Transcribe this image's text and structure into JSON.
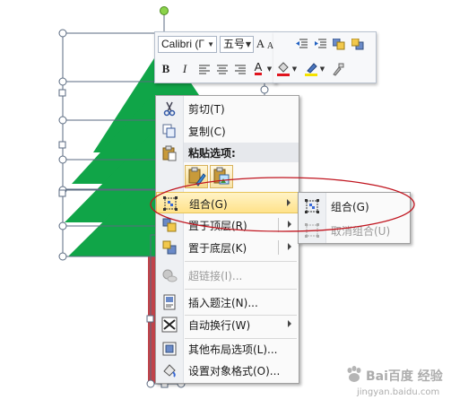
{
  "mini_toolbar": {
    "font_name": "Calibri (Г",
    "font_size": "五号",
    "grow_font_label": "A",
    "shrink_font_label": "A",
    "bold_label": "B",
    "italic_label": "I",
    "font_color_label": "A",
    "font_color": "#e0141e",
    "highlight_color": "#f5e200",
    "fill_color": "#e0141e"
  },
  "context_menu": {
    "items": [
      {
        "label": "剪切(T)",
        "icon": "cut-icon"
      },
      {
        "label": "复制(C)",
        "icon": "copy-icon"
      },
      {
        "label": "粘贴选项:",
        "icon": "paste-icon"
      },
      {
        "label": "组合(G)",
        "icon": "group-icon"
      },
      {
        "label": "置于顶层(R)",
        "icon": "bring-to-front-icon"
      },
      {
        "label": "置于底层(K)",
        "icon": "send-to-back-icon"
      },
      {
        "label": "超链接(I)...",
        "icon": "hyperlink-icon"
      },
      {
        "label": "插入题注(N)...",
        "icon": "insert-caption-icon"
      },
      {
        "label": "自动换行(W)",
        "icon": "text-wrap-icon"
      },
      {
        "label": "其他布局选项(L)...",
        "icon": "layout-options-icon"
      },
      {
        "label": "设置对象格式(O)...",
        "icon": "format-object-icon"
      }
    ]
  },
  "submenu": {
    "items": [
      {
        "label": "组合(G)",
        "icon": "group-icon"
      },
      {
        "label": "取消组合(U)",
        "icon": "ungroup-icon"
      }
    ]
  },
  "watermark": {
    "text": "Bai百度 经验",
    "url": "jingyan.baidu.com"
  },
  "colors": {
    "tree_green": "#10a548",
    "annotation_red": "#c0141e",
    "highlight": "#ffe28a"
  }
}
